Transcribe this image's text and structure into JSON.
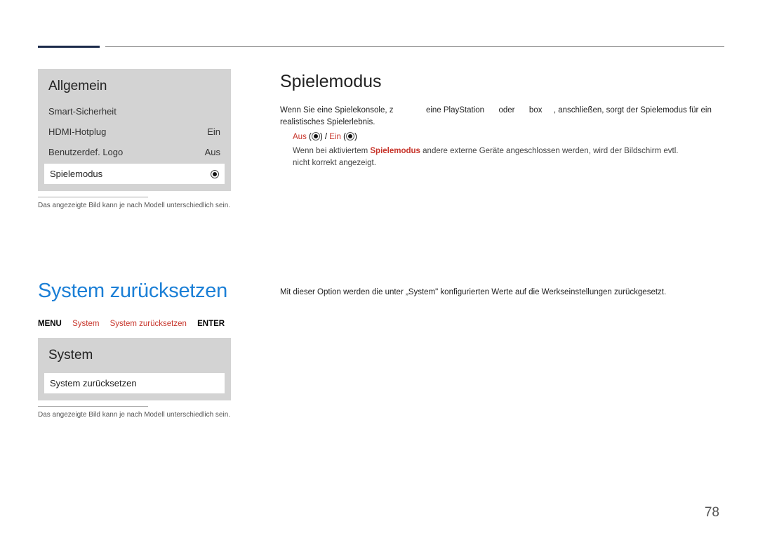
{
  "page_number": "78",
  "section1": {
    "menu": {
      "title": "Allgemein",
      "items": [
        {
          "label": "Smart-Sicherheit",
          "value": ""
        },
        {
          "label": "HDMI-Hotplug",
          "value": "Ein"
        },
        {
          "label": "Benutzerdef. Logo",
          "value": "Aus"
        }
      ],
      "selected": {
        "label": "Spielemodus"
      }
    },
    "fig_note": "Das angezeigte Bild kann je nach Modell unterschiedlich sein.",
    "heading": "Spielemodus",
    "desc_line1_a": "Wenn Sie eine Spielekonsole, z",
    "desc_line1_b": "eine PlayStation",
    "desc_line1_c": "oder",
    "desc_line1_d": "box",
    "desc_line1_e": ", anschließen, sorgt der Spielemodus für ein",
    "desc_line2": "realistisches Spielerlebnis.",
    "opt_aus": "Aus",
    "opt_ein": "Ein",
    "note_a": "Wenn bei aktiviertem ",
    "note_bold": "Spielemodus",
    "note_b": " andere externe Geräte angeschlossen werden, wird der Bildschirm evtl.",
    "note_c": "nicht korrekt angezeigt."
  },
  "section2": {
    "heading": "System zurücksetzen",
    "breadcrumb": {
      "menu": "MENU",
      "system": "System",
      "reset": "System zurücksetzen",
      "enter": "ENTER"
    },
    "menu": {
      "title": "System",
      "selected": "System zurücksetzen"
    },
    "fig_note": "Das angezeigte Bild kann je nach Modell unterschiedlich sein.",
    "desc": "Mit dieser Option werden die unter „System\" konfigurierten Werte auf die Werkseinstellungen zurückgesetzt."
  }
}
